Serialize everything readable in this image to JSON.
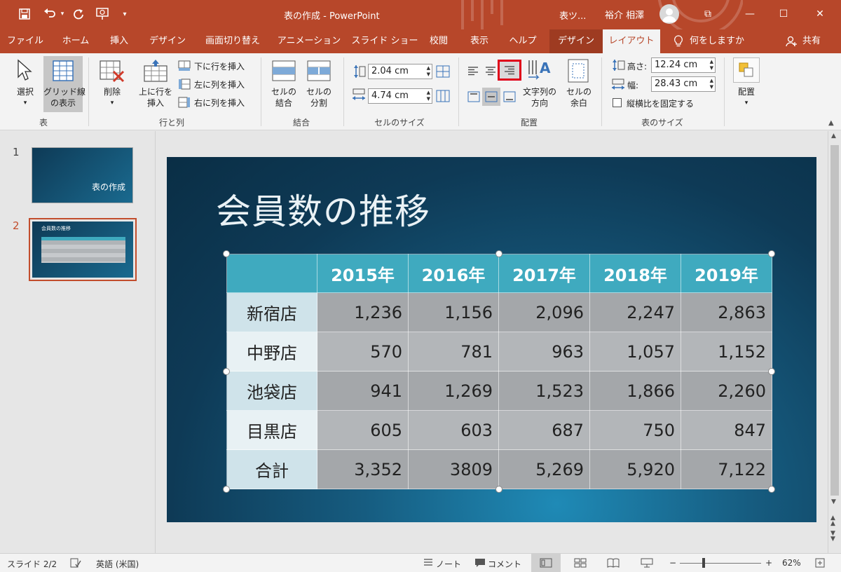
{
  "titlebar": {
    "doc_title": "表の作成 - PowerPoint",
    "context_tab_label": "表ツ...",
    "user_name": "裕介 相澤",
    "qat_customize": "▾",
    "win_restore": "⧉",
    "win_minimize": "—",
    "win_maximize": "☐",
    "win_close": "✕"
  },
  "tabs": {
    "file": "ファイル",
    "home": "ホーム",
    "insert": "挿入",
    "design": "デザイン",
    "transitions": "画面切り替え",
    "animations": "アニメーション",
    "slideshow": "スライド ショー",
    "review": "校閲",
    "view": "表示",
    "help": "ヘルプ",
    "table_design": "デザイン",
    "layout": "レイアウト",
    "tell_me": "何をしますか",
    "share": "共有"
  },
  "ribbon": {
    "group_table": "表",
    "select": "選択",
    "gridlines_1": "グリッド線",
    "gridlines_2": "の表示",
    "group_rows_cols": "行と列",
    "delete": "削除",
    "insert_above_1": "上に行を",
    "insert_above_2": "挿入",
    "insert_below": "下に行を挿入",
    "insert_left": "左に列を挿入",
    "insert_right": "右に列を挿入",
    "group_merge": "結合",
    "merge_cells_1": "セルの",
    "merge_cells_2": "結合",
    "split_cells_1": "セルの",
    "split_cells_2": "分割",
    "group_cell_size": "セルのサイズ",
    "cell_height": "2.04 cm",
    "cell_width": "4.74 cm",
    "group_alignment": "配置",
    "text_direction_1": "文字列の",
    "text_direction_2": "方向",
    "cell_margins_1": "セルの",
    "cell_margins_2": "余白",
    "group_table_size": "表のサイズ",
    "height_label": "高さ:",
    "height_value": "12.24 cm",
    "width_label": "幅:",
    "width_value": "28.43 cm",
    "lock_aspect": "縦横比を固定する",
    "arrange": "配置",
    "dropdown_arrow": "▾"
  },
  "thumbnails": {
    "num1": "1",
    "num2": "2",
    "thumb1_title": "表の作成",
    "thumb2_title": "会員数の推移"
  },
  "slide": {
    "title": "会員数の推移",
    "table": {
      "headers": [
        "",
        "2015年",
        "2016年",
        "2017年",
        "2018年",
        "2019年"
      ],
      "rows": [
        [
          "新宿店",
          "1,236",
          "1,156",
          "2,096",
          "2,247",
          "2,863"
        ],
        [
          "中野店",
          "570",
          "781",
          "963",
          "1,057",
          "1,152"
        ],
        [
          "池袋店",
          "941",
          "1,269",
          "1,523",
          "1,866",
          "2,260"
        ],
        [
          "目黒店",
          "605",
          "603",
          "687",
          "750",
          "847"
        ],
        [
          "合計",
          "3,352",
          "3809",
          "5,269",
          "5,920",
          "7,122"
        ]
      ]
    }
  },
  "statusbar": {
    "slide_info": "スライド 2/2",
    "language": "英語 (米国)",
    "notes": "ノート",
    "comments": "コメント",
    "zoom_minus": "−",
    "zoom_plus": "+",
    "zoom": "62%"
  },
  "colors": {
    "accent": "#b7472a",
    "table_header": "#3faabf",
    "highlight_box": "#e0001a"
  }
}
